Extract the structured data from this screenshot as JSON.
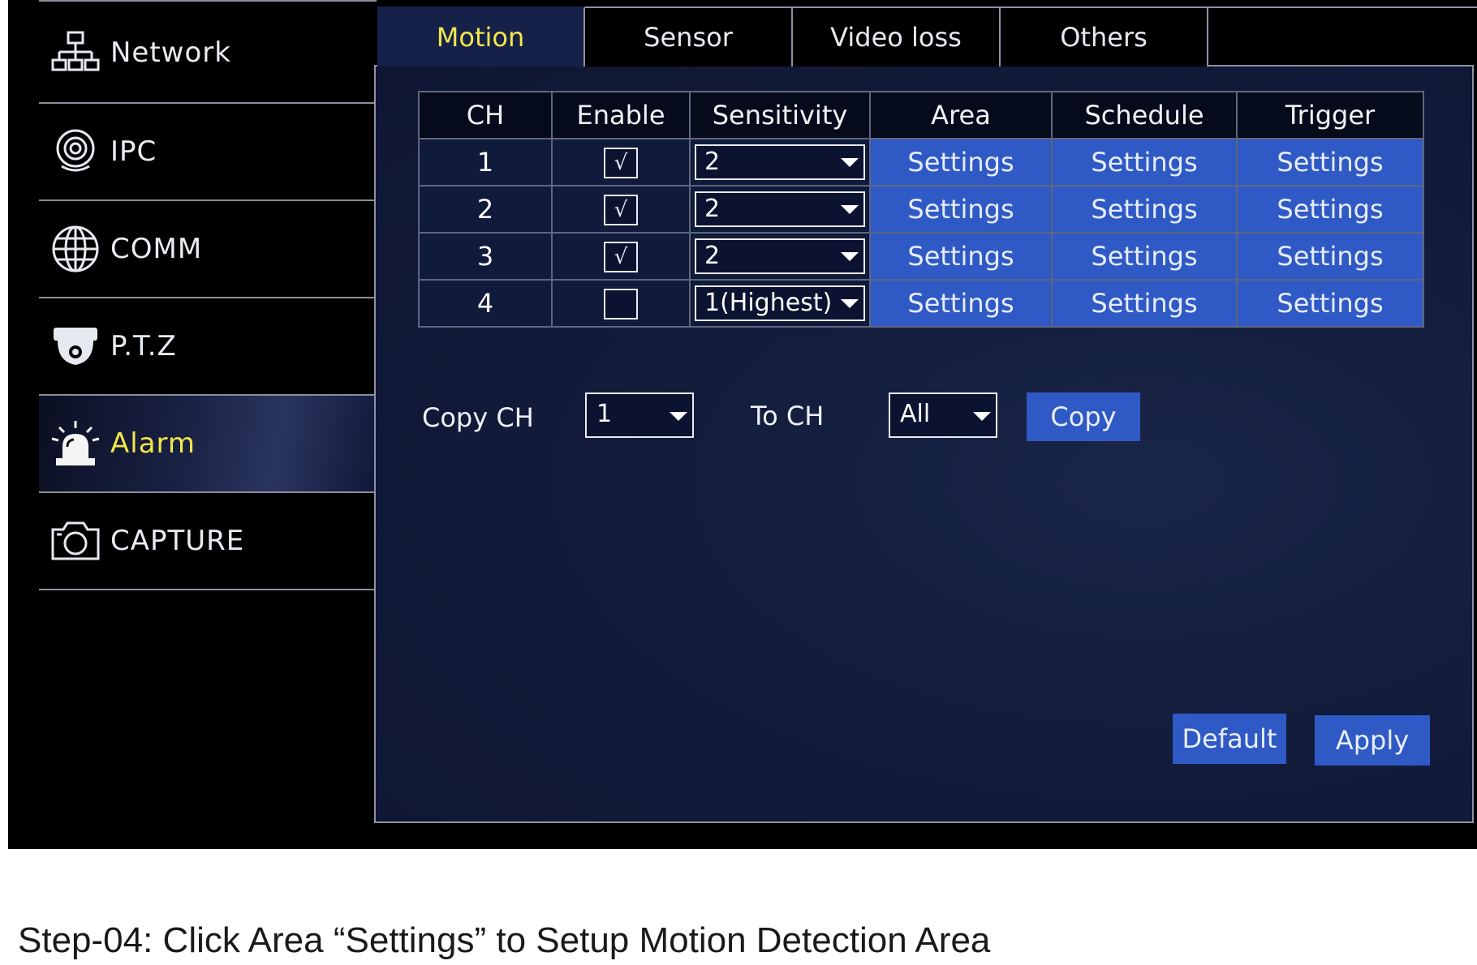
{
  "sidebar": {
    "items": [
      {
        "label": "Network",
        "icon": "network-icon",
        "active": false
      },
      {
        "label": "IPC",
        "icon": "ipc-camera-icon",
        "active": false
      },
      {
        "label": "COMM",
        "icon": "globe-icon",
        "active": false
      },
      {
        "label": "P.T.Z",
        "icon": "dome-camera-icon",
        "active": false
      },
      {
        "label": "Alarm",
        "icon": "alarm-siren-icon",
        "active": true
      },
      {
        "label": "CAPTURE",
        "icon": "camera-icon",
        "active": false
      }
    ]
  },
  "tabs": [
    {
      "label": "Motion",
      "active": true
    },
    {
      "label": "Sensor",
      "active": false
    },
    {
      "label": "Video loss",
      "active": false
    },
    {
      "label": "Others",
      "active": false
    }
  ],
  "table": {
    "headers": [
      "CH",
      "Enable",
      "Sensitivity",
      "Area",
      "Schedule",
      "Trigger"
    ],
    "rows": [
      {
        "ch": "1",
        "enable_mark": "√",
        "sensitivity": "2",
        "area": "Settings",
        "schedule": "Settings",
        "trigger": "Settings"
      },
      {
        "ch": "2",
        "enable_mark": "√",
        "sensitivity": "2",
        "area": "Settings",
        "schedule": "Settings",
        "trigger": "Settings"
      },
      {
        "ch": "3",
        "enable_mark": "√",
        "sensitivity": "2",
        "area": "Settings",
        "schedule": "Settings",
        "trigger": "Settings"
      },
      {
        "ch": "4",
        "enable_mark": "",
        "sensitivity": "1(Highest)",
        "area": "Settings",
        "schedule": "Settings",
        "trigger": "Settings"
      }
    ]
  },
  "copy": {
    "from_label": "Copy CH",
    "from_value": "1",
    "to_label": "To CH",
    "to_value": "All",
    "button_label": "Copy"
  },
  "footer": {
    "default_label": "Default",
    "apply_label": "Apply"
  },
  "caption": "Step-04: Click Area “Settings” to Setup Motion Detection Area",
  "colors": {
    "active_text": "#f2e64a",
    "button_blue": "#2f59c4",
    "panel_bg": "#121c3b"
  }
}
